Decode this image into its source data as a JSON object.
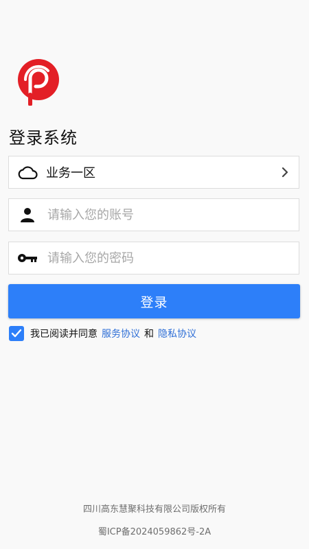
{
  "title": "登录系统",
  "region": {
    "value": "业务一区",
    "icon": "cloud-icon"
  },
  "account": {
    "placeholder": "请输入您的账号",
    "value": "",
    "icon": "person-icon"
  },
  "password": {
    "placeholder": "请输入您的密码",
    "value": "",
    "icon": "key-icon"
  },
  "login_button": "登录",
  "agreement": {
    "checked": true,
    "text": "我已阅读并同意",
    "service_link": "服务协议",
    "and": "和",
    "privacy_link": "隐私协议"
  },
  "footer": {
    "copyright": "四川高东慧聚科技有限公司版权所有",
    "icp": "蜀ICP备2024059862号-2A"
  },
  "colors": {
    "accent": "#2d7ff9",
    "logo_red": "#e31f26",
    "link": "#2f6fd6"
  }
}
